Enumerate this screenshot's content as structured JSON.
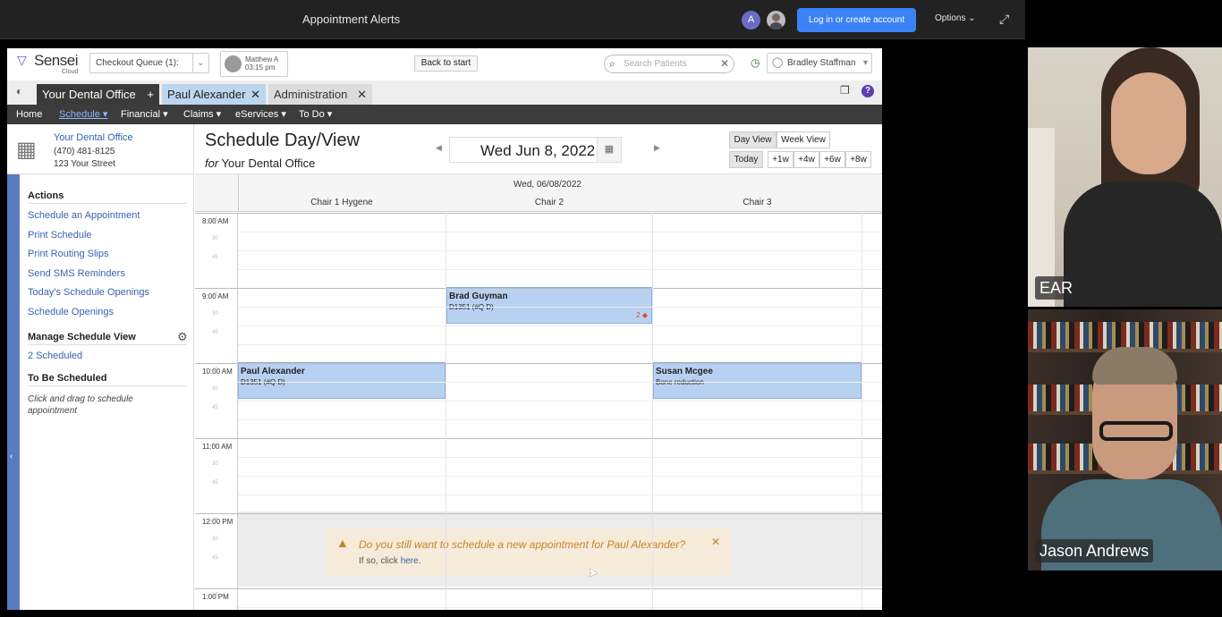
{
  "meeting": {
    "title": "Appointment Alerts",
    "avatar_letter": "A",
    "login_label": "Log in or create account",
    "options_label": "Options",
    "options_caret": "⌄",
    "expand_icon": "⤢"
  },
  "app": {
    "logo": {
      "mark": "▽",
      "brand": "Sensei",
      "sub": "Cloud"
    },
    "checkout_queue": "Checkout Queue (1):",
    "user": {
      "name": "Matthew A",
      "time": "03:15 pm"
    },
    "back_to_start": "Back to start",
    "search_placeholder": "Search Patients",
    "staff": "Bradley Staffman",
    "tabs": [
      {
        "label": "Your Dental Office",
        "icon": "+"
      },
      {
        "label": "Paul Alexander",
        "icon": "✕"
      },
      {
        "label": "Administration",
        "icon": "✕"
      }
    ],
    "nav": [
      "Home",
      "Schedule ▾",
      "Financial ▾",
      "Claims ▾",
      "eServices ▾",
      "To Do ▾"
    ],
    "office": {
      "name": "Your Dental Office",
      "phone": "(470) 481-8125",
      "street": "123 Your Street"
    },
    "schedule": {
      "title": "Schedule Day/View",
      "for_prefix": "for",
      "for_office": "Your Dental Office",
      "date": "Wed Jun 8, 2022",
      "day_view": "Day View",
      "week_view": "Week View",
      "today": "Today",
      "jumps": [
        "+1w",
        "+4w",
        "+6w",
        "+8w"
      ]
    },
    "sidebar": {
      "actions_heading": "Actions",
      "actions": [
        "Schedule an Appointment",
        "Print Schedule",
        "Print Routing Slips",
        "Send SMS Reminders",
        "Today's Schedule Openings",
        "Schedule Openings"
      ],
      "manage_heading": "Manage Schedule View",
      "scheduled_link": "2 Scheduled",
      "tbs_heading": "To Be Scheduled",
      "tbs_hint": "Click and drag to schedule appointment"
    },
    "grid": {
      "date": "Wed, 06/08/2022",
      "chairs": [
        "Chair 1 Hygene",
        "Chair 2",
        "Chair 3"
      ],
      "hours": [
        "8:00 AM",
        "9:00 AM",
        "10:00 AM",
        "11:00 AM",
        "12:00 PM",
        "1:00 PM"
      ],
      "minutes": [
        "15",
        "30",
        "45"
      ]
    },
    "appointments": [
      {
        "name": "Brad Guyman",
        "code": "D1351 (#Q D)",
        "flag": "2 ◆",
        "chair": "Chair 2",
        "start": "9:00 AM"
      },
      {
        "name": "Paul Alexander",
        "code": "D1351 (#Q D)",
        "flag": "",
        "chair": "Chair 1 Hygene",
        "start": "10:00 AM"
      },
      {
        "name": "Susan Mcgee",
        "code": "Bone reduction",
        "flag": "",
        "chair": "Chair 3",
        "start": "10:00 AM"
      }
    ],
    "alert": {
      "message": "Do you still want to schedule a new appointment for Paul Alexander?",
      "sub_prefix": "If so, click",
      "sub_link": "here."
    }
  },
  "participants": [
    {
      "name": "EAR"
    },
    {
      "name": "Jason Andrews"
    }
  ]
}
